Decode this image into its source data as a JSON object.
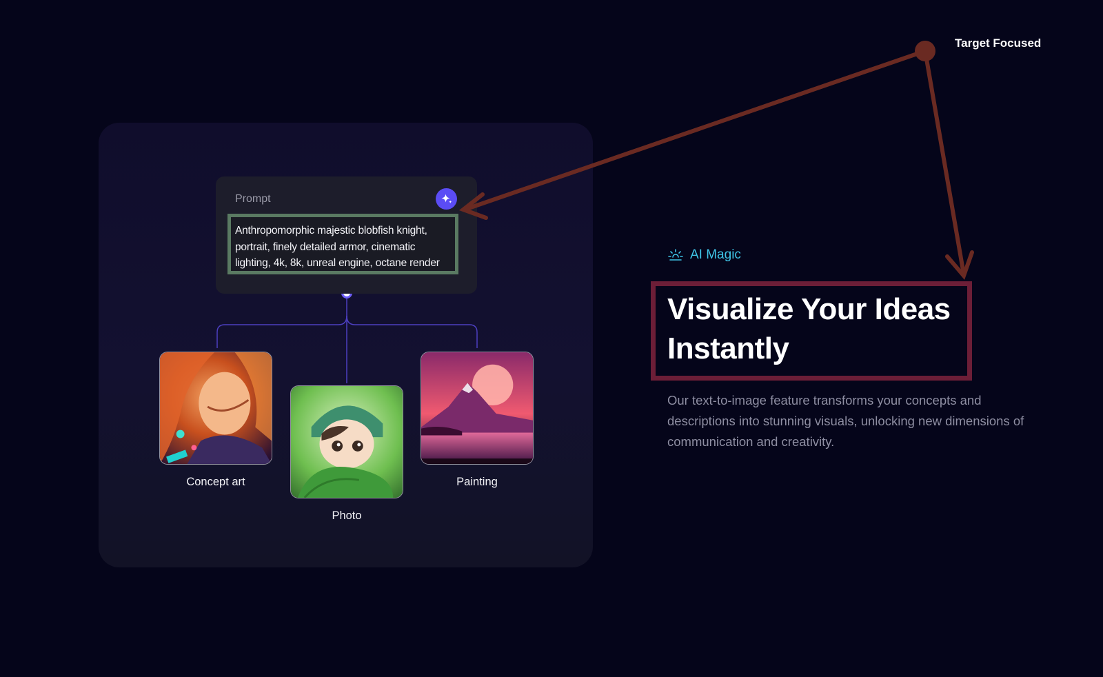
{
  "annotation": {
    "target_label": "Target Focused"
  },
  "prompt_card": {
    "label": "Prompt",
    "text": "Anthropomorphic majestic blobfish knight, portrait, finely detailed armor, cinematic lighting, 4k, 8k, unreal engine, octane render",
    "magic_button_icon": "sparkle-icon"
  },
  "outputs": [
    {
      "label": "Concept art",
      "icon": "woman-portrait-image"
    },
    {
      "label": "Photo",
      "icon": "baby-character-image"
    },
    {
      "label": "Painting",
      "icon": "mountain-sunset-image"
    }
  ],
  "feature": {
    "badge_icon": "sparkle-burst-icon",
    "badge_label": "AI Magic",
    "headline": "Visualize Your Ideas Instantly",
    "description": "Our text-to-image feature transforms your concepts and descriptions into stunning visuals, unlocking new dimensions of communication and creativity."
  },
  "colors": {
    "background": "#05051a",
    "card": "#121128",
    "accent_purple": "#5b4cf5",
    "badge_cyan": "#3fc4e6",
    "annotation_arrow": "#6a2a22",
    "input_highlight": "#5a7a62",
    "headline_highlight": "#6c1e37"
  }
}
